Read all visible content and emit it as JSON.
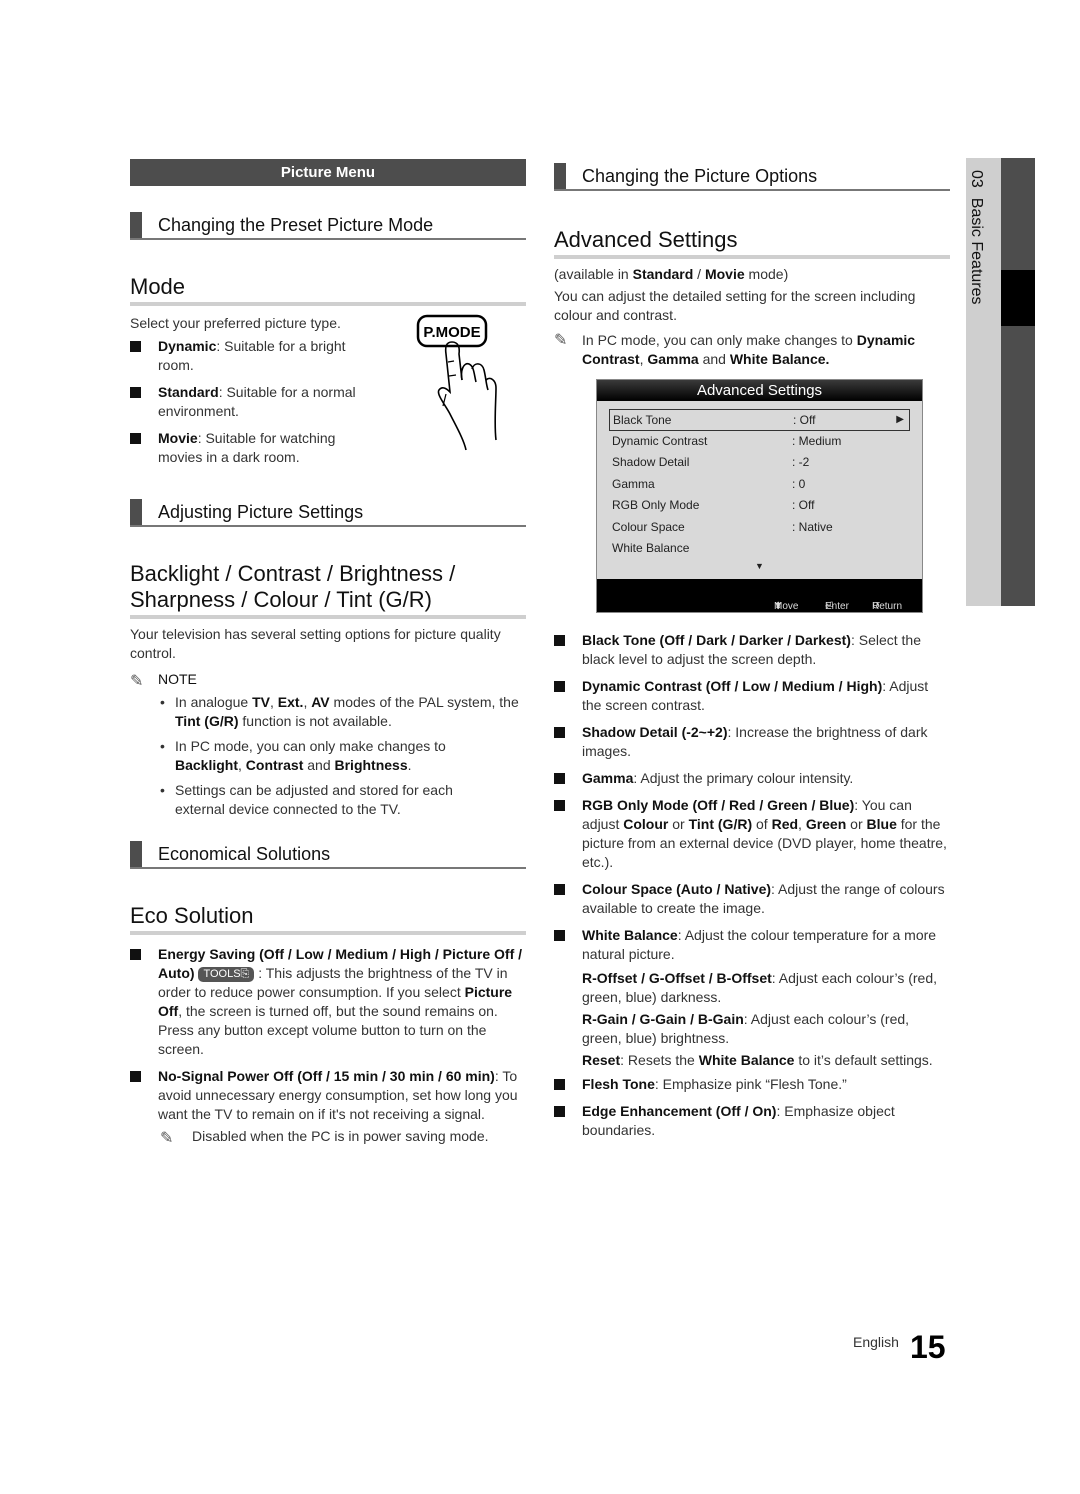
{
  "left": {
    "menu_bar": "Picture Menu",
    "sub1": "Changing the Preset Picture Mode",
    "mode_title": "Mode",
    "mode_intro": "Select your preferred picture type.",
    "pmode_label": "P.MODE",
    "mode_items": [
      {
        "term": "Dynamic",
        "desc": ": Suitable for a bright room."
      },
      {
        "term": "Standard",
        "desc": ": Suitable for a normal environment."
      },
      {
        "term": "Movie",
        "desc": ": Suitable for watching movies in a dark room."
      }
    ],
    "sub2": "Adjusting Picture Settings",
    "backlight_title_1": "Backlight / Contrast / Brightness /",
    "backlight_title_2": "Sharpness / Colour / Tint (G/R)",
    "backlight_intro": "Your television has several setting options for picture quality control.",
    "note_label": "NOTE",
    "notes": {
      "n1": {
        "a": "In analogue ",
        "b1": "TV",
        "c": ", ",
        "b2": "Ext.",
        "d": ", ",
        "b3": "AV",
        "e": " modes of the PAL system, the ",
        "b4": "Tint (G/R)",
        "f": " function is not available."
      },
      "n2": {
        "a": "In PC mode, you can only make changes to ",
        "b1": "Backlight",
        "c": ", ",
        "b2": "Contrast",
        "d": " and ",
        "b3": "Brightness",
        "e": "."
      },
      "n3": "Settings can be adjusted and stored for each external device connected to the TV."
    },
    "sub3": "Economical Solutions",
    "eco_title": "Eco Solution",
    "eco": {
      "energy_term": "Energy Saving (Off / Low / Medium / High / Picture Off / Auto)",
      "tools_label": "TOOLS",
      "energy_a": " : This adjusts the brightness of the TV in order to reduce power consumption. If you select ",
      "energy_b": "Picture Off",
      "energy_c": ", the screen is turned off, but the sound remains on. Press any button except volume button to turn on the screen.",
      "nosignal_term": "No-Signal Power Off (Off / 15 min / 30 min / 60 min)",
      "nosignal_desc": ": To avoid unnecessary energy consumption, set how long you want the TV to remain on if it's not receiving a signal.",
      "nosignal_note": "Disabled when the PC is in power saving mode."
    }
  },
  "right": {
    "sub1": "Changing the Picture Options",
    "adv_title": "Advanced Settings",
    "avail_a": "(available in ",
    "avail_b1": "Standard",
    "avail_c": " / ",
    "avail_b2": "Movie",
    "avail_d": " mode)",
    "adv_intro": "You can adjust the detailed setting for the screen including colour and contrast.",
    "pc_note": {
      "a": "In PC mode, you can only make changes to ",
      "b1": "Dynamic Contrast",
      "c": ", ",
      "b2": "Gamma",
      "d": " and ",
      "b3": "White Balance."
    },
    "osd": {
      "title": "Advanced Settings",
      "rows": [
        {
          "label": "Black Tone",
          "value": ": Off"
        },
        {
          "label": "Dynamic Contrast",
          "value": ": Medium"
        },
        {
          "label": "Shadow Detail",
          "value": ": -2"
        },
        {
          "label": "Gamma",
          "value": ": 0"
        },
        {
          "label": "RGB Only Mode",
          "value": ": Off"
        },
        {
          "label": "Colour Space",
          "value": ": Native"
        },
        {
          "label": "White Balance",
          "value": ""
        }
      ],
      "footer": {
        "move": "Move",
        "enter": "Enter",
        "return": "Return"
      }
    },
    "items": [
      {
        "term": "Black Tone (Off / Dark / Darker / Darkest)",
        "desc": ": Select the black level to adjust the screen depth."
      },
      {
        "term": "Dynamic Contrast (Off / Low / Medium / High)",
        "desc": ": Adjust the screen contrast."
      },
      {
        "term": "Shadow Detail (-2~+2)",
        "desc": ": Increase the brightness of dark images."
      },
      {
        "term": "Gamma",
        "desc": ": Adjust the primary colour intensity."
      }
    ],
    "rgb": {
      "term": "RGB Only Mode (Off / Red / Green / Blue)",
      "a": ": You can adjust ",
      "b1": "Colour",
      "c": " or ",
      "b2": "Tint (G/R)",
      "d": " of ",
      "b3": "Red",
      "e": ", ",
      "b4": "Green",
      "f": " or ",
      "b5": "Blue",
      "g": " for the picture from an external device (DVD player, home theatre, etc.)."
    },
    "colour_space": {
      "term": "Colour Space (Auto / Native)",
      "desc": ": Adjust the range of colours available to create the image."
    },
    "white_balance": {
      "term": "White Balance",
      "desc": ": Adjust the colour temperature for a more natural picture."
    },
    "wb_sub": {
      "offset_term": "R-Offset / G-Offset / B-Offset",
      "offset_desc": ": Adjust each colour’s (red, green, blue) darkness.",
      "gain_term": "R-Gain / G-Gain / B-Gain",
      "gain_desc": ": Adjust each colour’s (red, green, blue) brightness.",
      "reset_term": "Reset",
      "reset_a": ": Resets the ",
      "reset_b": "White Balance",
      "reset_c": " to it’s default settings."
    },
    "flesh": {
      "term": "Flesh Tone",
      "desc": ": Emphasize pink “Flesh Tone.”"
    },
    "edge": {
      "term": "Edge Enhancement (Off / On)",
      "desc": ": Emphasize object boundaries."
    }
  },
  "side_tab": {
    "number": "03",
    "label": "Basic Features"
  },
  "footer": {
    "language": "English",
    "page": "15"
  }
}
